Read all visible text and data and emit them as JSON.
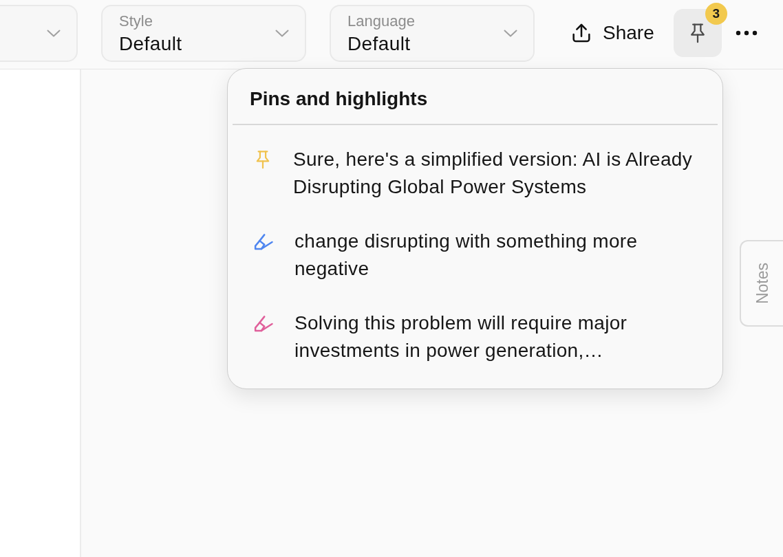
{
  "toolbar": {
    "dropdowns": [
      {
        "kind": "clipped"
      },
      {
        "kind": "select",
        "label": "Style",
        "value": "Default"
      },
      {
        "kind": "select",
        "label": "Language",
        "value": "Default"
      }
    ],
    "share_button": {
      "label": "Share"
    },
    "pins_button": {
      "badge": "3",
      "expanded": true
    }
  },
  "pins_popover": {
    "title": "Pins and highlights",
    "items": [
      {
        "kind": "pin",
        "color": "#f0c24e",
        "text": "Sure, here's a simplified version: AI is Already Disrupting Global Power Systems"
      },
      {
        "kind": "highlight",
        "color": "#4f86f0",
        "text": "change disrupting with something more negative"
      },
      {
        "kind": "highlight",
        "color": "#e0609b",
        "text": "Solving this problem will require major investments in power generation,…"
      }
    ]
  },
  "notes_tab": {
    "label": "Notes"
  }
}
